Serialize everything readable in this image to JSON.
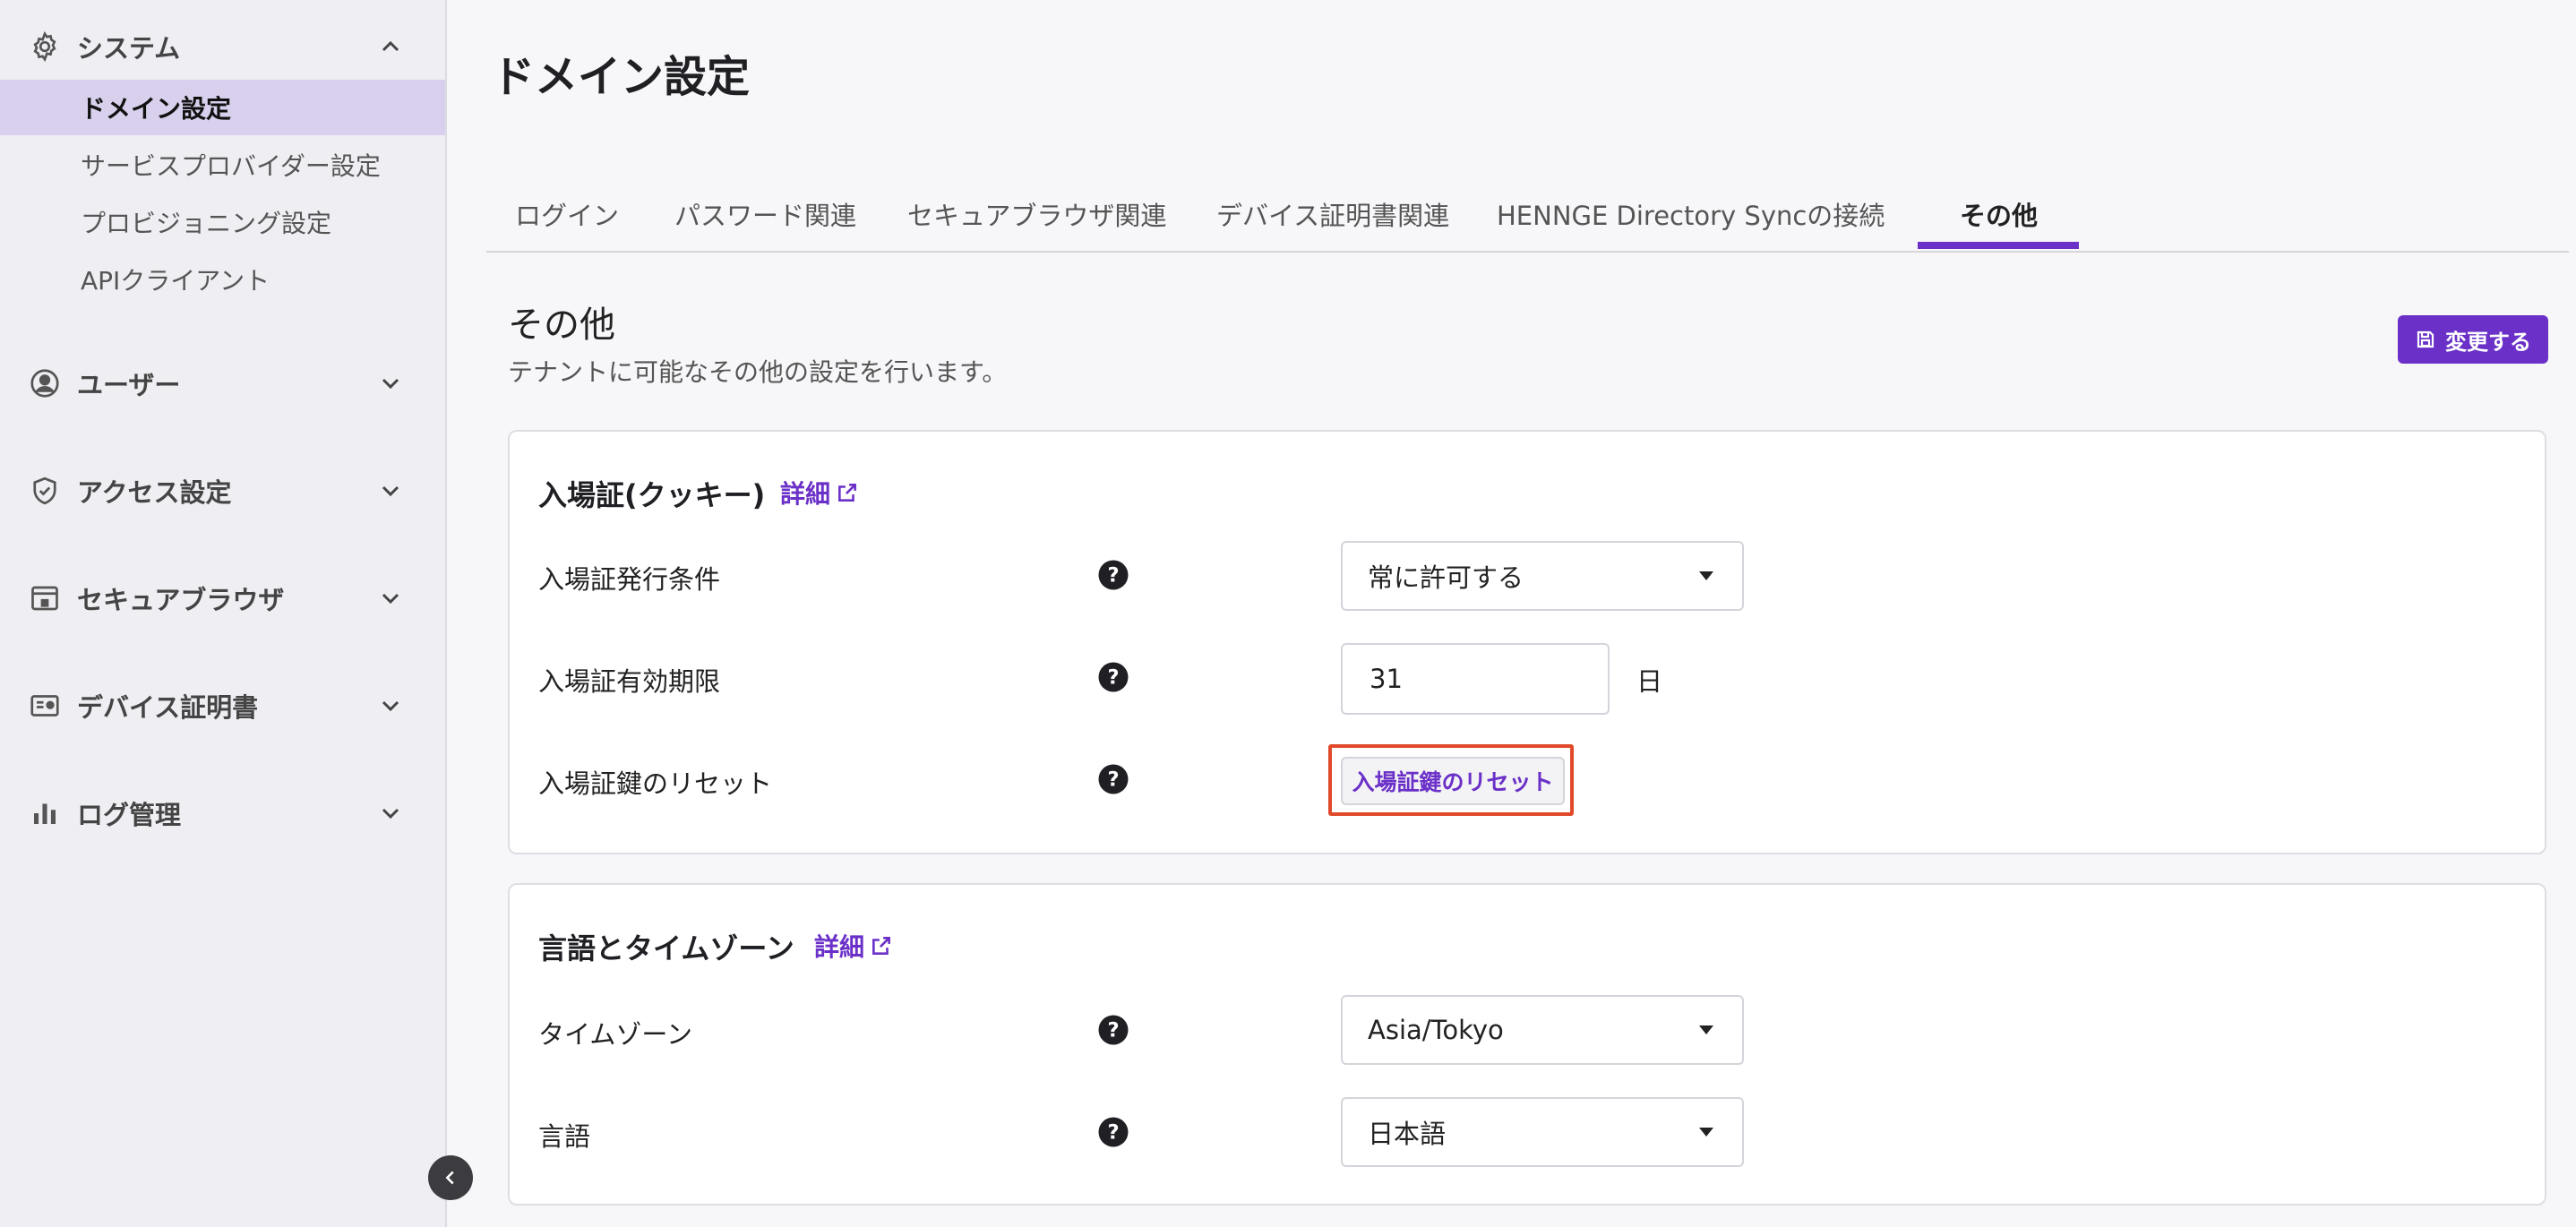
{
  "sidebar": {
    "system": {
      "label": "システム",
      "items": [
        "ドメイン設定",
        "サービスプロバイダー設定",
        "プロビジョニング設定",
        "APIクライアント"
      ]
    },
    "sections": [
      {
        "label": "ユーザー",
        "icon": "user-icon"
      },
      {
        "label": "アクセス設定",
        "icon": "shield-icon"
      },
      {
        "label": "セキュアブラウザ",
        "icon": "browser-icon"
      },
      {
        "label": "デバイス証明書",
        "icon": "certificate-icon"
      },
      {
        "label": "ログ管理",
        "icon": "bar-chart-icon"
      }
    ]
  },
  "page": {
    "title": "ドメイン設定",
    "tabs": [
      "ログイン",
      "パスワード関連",
      "セキュアブラウザ関連",
      "デバイス証明書関連",
      "HENNGE Directory Syncの接続",
      "その他"
    ],
    "active_tab": "その他",
    "section_title": "その他",
    "section_desc": "テナントに可能なその他の設定を行います。",
    "save_label": "変更する"
  },
  "cookie_card": {
    "title": "入場証(クッキー)",
    "detail": "詳細",
    "rows": {
      "issue_label": "入場証発行条件",
      "issue_value": "常に許可する",
      "expiry_label": "入場証有効期限",
      "expiry_value": "31",
      "expiry_unit": "日",
      "reset_label": "入場証鍵のリセット",
      "reset_button": "入場証鍵のリセット"
    }
  },
  "lang_card": {
    "title": "言語とタイムゾーン",
    "detail": "詳細",
    "timezone_label": "タイムゾーン",
    "timezone_value": "Asia/Tokyo",
    "language_label": "言語",
    "language_value": "日本語"
  },
  "colors": {
    "accent": "#6a30c8",
    "highlight": "#e04a2a"
  }
}
